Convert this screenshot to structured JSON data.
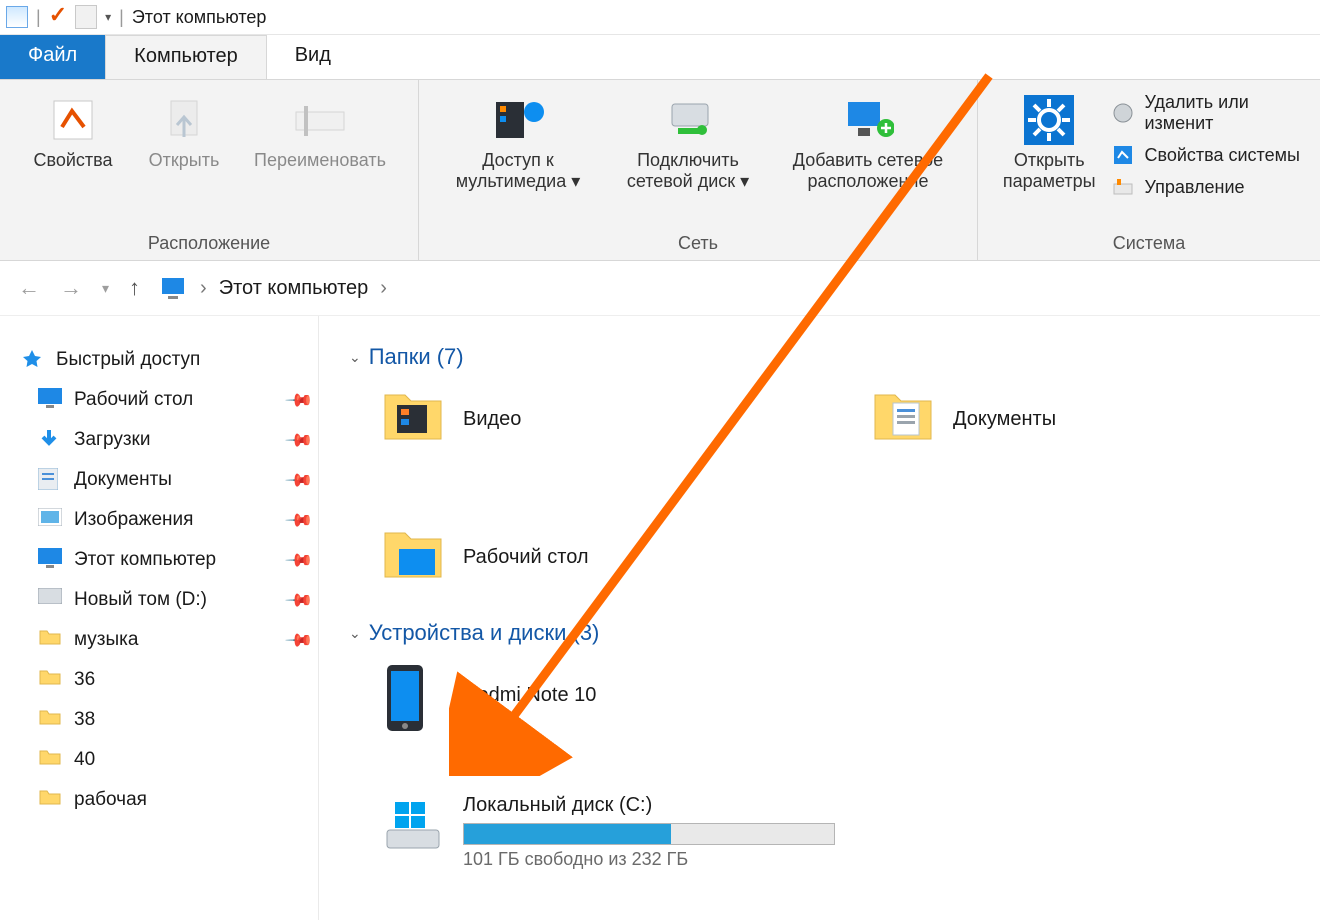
{
  "window": {
    "title": "Этот компьютер"
  },
  "tabs": {
    "file": "Файл",
    "computer": "Компьютер",
    "view": "Вид"
  },
  "ribbon": {
    "location": {
      "label": "Расположение",
      "properties": "Свойства",
      "open": "Открыть",
      "rename": "Переименовать"
    },
    "network": {
      "label": "Сеть",
      "media": "Доступ к мультимедиа",
      "map_drive": "Подключить сетевой диск",
      "add_location": "Добавить сетевое расположение"
    },
    "system": {
      "label": "Система",
      "open_settings": "Открыть параметры",
      "uninstall": "Удалить или изменит",
      "system_properties": "Свойства системы",
      "manage": "Управление"
    }
  },
  "breadcrumb": {
    "root": "Этот компьютер"
  },
  "sidebar": {
    "quick": "Быстрый доступ",
    "items": [
      "Рабочий стол",
      "Загрузки",
      "Документы",
      "Изображения",
      "Этот компьютер",
      "Новый том (D:)",
      "музыка",
      "36",
      "38",
      "40",
      "рабочая"
    ]
  },
  "sections": {
    "folders": {
      "title": "Папки (7)",
      "items": [
        "Видео",
        "Документы",
        "Рабочий стол"
      ]
    },
    "devices": {
      "title": "Устройства и диски (3)",
      "phone": "Redmi Note 10",
      "disk": {
        "name": "Локальный диск (C:)",
        "free": "101 ГБ свободно из 232 ГБ",
        "fill_pct": 56
      }
    }
  }
}
